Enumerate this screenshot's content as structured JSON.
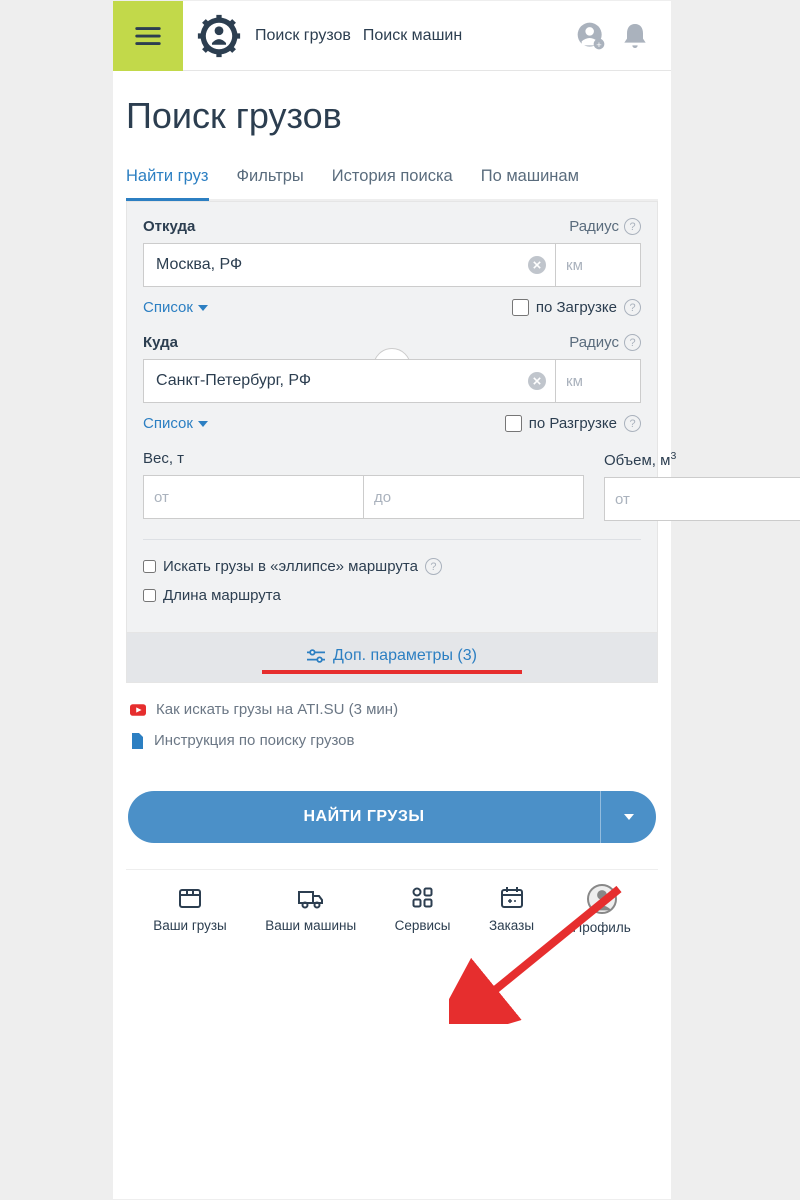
{
  "header": {
    "link_cargo": "Поиск грузов",
    "link_trucks": "Поиск машин"
  },
  "page": {
    "title": "Поиск грузов"
  },
  "tabs": [
    {
      "label": "Найти груз",
      "active": true
    },
    {
      "label": "Фильтры"
    },
    {
      "label": "История поиска"
    },
    {
      "label": "По машинам"
    }
  ],
  "form": {
    "from_label": "Откуда",
    "radius_label": "Радиус",
    "from_value": "Москва, РФ",
    "radius_ph": "км",
    "list_link": "Список",
    "by_load": "по Загрузке",
    "to_label": "Куда",
    "to_value": "Санкт-Петербург, РФ",
    "by_unload": "по Разгрузке",
    "weight_label": "Вес, т",
    "volume_label": "Объем, м",
    "volume_sup": "3",
    "from_ph": "от",
    "to_ph": "до",
    "ellipse": "Искать грузы в «эллипсе» маршрута",
    "route_length": "Длина маршрута"
  },
  "extra": {
    "label": "Доп. параметры (3)"
  },
  "help": {
    "video": "Как искать грузы на ATI.SU (3 мин)",
    "doc": "Инструкция по поиску грузов"
  },
  "search_btn": "НАЙТИ ГРУЗЫ",
  "nav": {
    "cargo": "Ваши грузы",
    "trucks": "Ваши машины",
    "services": "Сервисы",
    "orders": "Заказы",
    "profile": "Профиль"
  }
}
